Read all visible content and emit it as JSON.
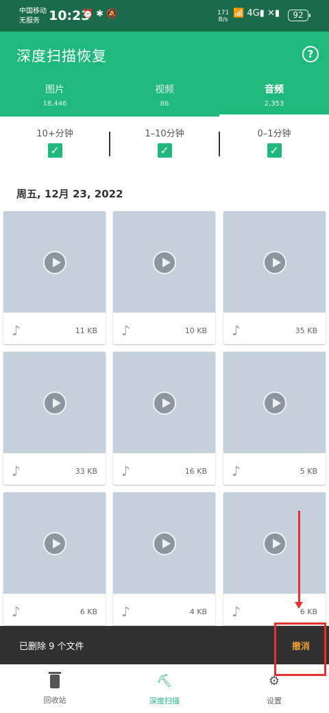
{
  "status_bar": {
    "carrier_line1": "中国移动",
    "carrier_line2": "无服务",
    "time": "10:23",
    "left_icons": "⏰✱🔕",
    "net_speed_value": "171",
    "net_speed_unit": "B/s",
    "right_icons": "📶 4G▮ ✕▮",
    "battery": "92"
  },
  "header": {
    "title": "深度扫描恢复",
    "help_icon": "?"
  },
  "tabs": [
    {
      "label": "图片",
      "count": "18,446"
    },
    {
      "label": "视频",
      "count": "86"
    },
    {
      "label": "音频",
      "count": "2,353"
    }
  ],
  "filters": [
    {
      "label": "10+分钟",
      "checked": true
    },
    {
      "label": "1–10分钟",
      "checked": true
    },
    {
      "label": "0–1分钟",
      "checked": true
    }
  ],
  "check_mark": "✓",
  "date_heading": "周五, 12月 23, 2022",
  "files": [
    {
      "size": "11 KB"
    },
    {
      "size": "10 KB"
    },
    {
      "size": "35 KB"
    },
    {
      "size": "33 KB"
    },
    {
      "size": "16 KB"
    },
    {
      "size": "5 KB"
    },
    {
      "size": "6 KB"
    },
    {
      "size": "4 KB"
    },
    {
      "size": "6 KB"
    }
  ],
  "music_glyph": "♪",
  "snackbar": {
    "message": "已删除 9 个文件",
    "undo": "撤消"
  },
  "bottom_nav": [
    {
      "label": "回收站",
      "icon": "trash-icon"
    },
    {
      "label": "深度扫描",
      "icon": "scan-icon",
      "glyph": "⛏"
    },
    {
      "label": "设置",
      "icon": "gear-icon",
      "glyph": "⚙"
    }
  ],
  "colors": {
    "status_bar": "#1a6b4a",
    "accent": "#1fb97d",
    "undo": "#f0a030",
    "annotation": "#e53030"
  }
}
